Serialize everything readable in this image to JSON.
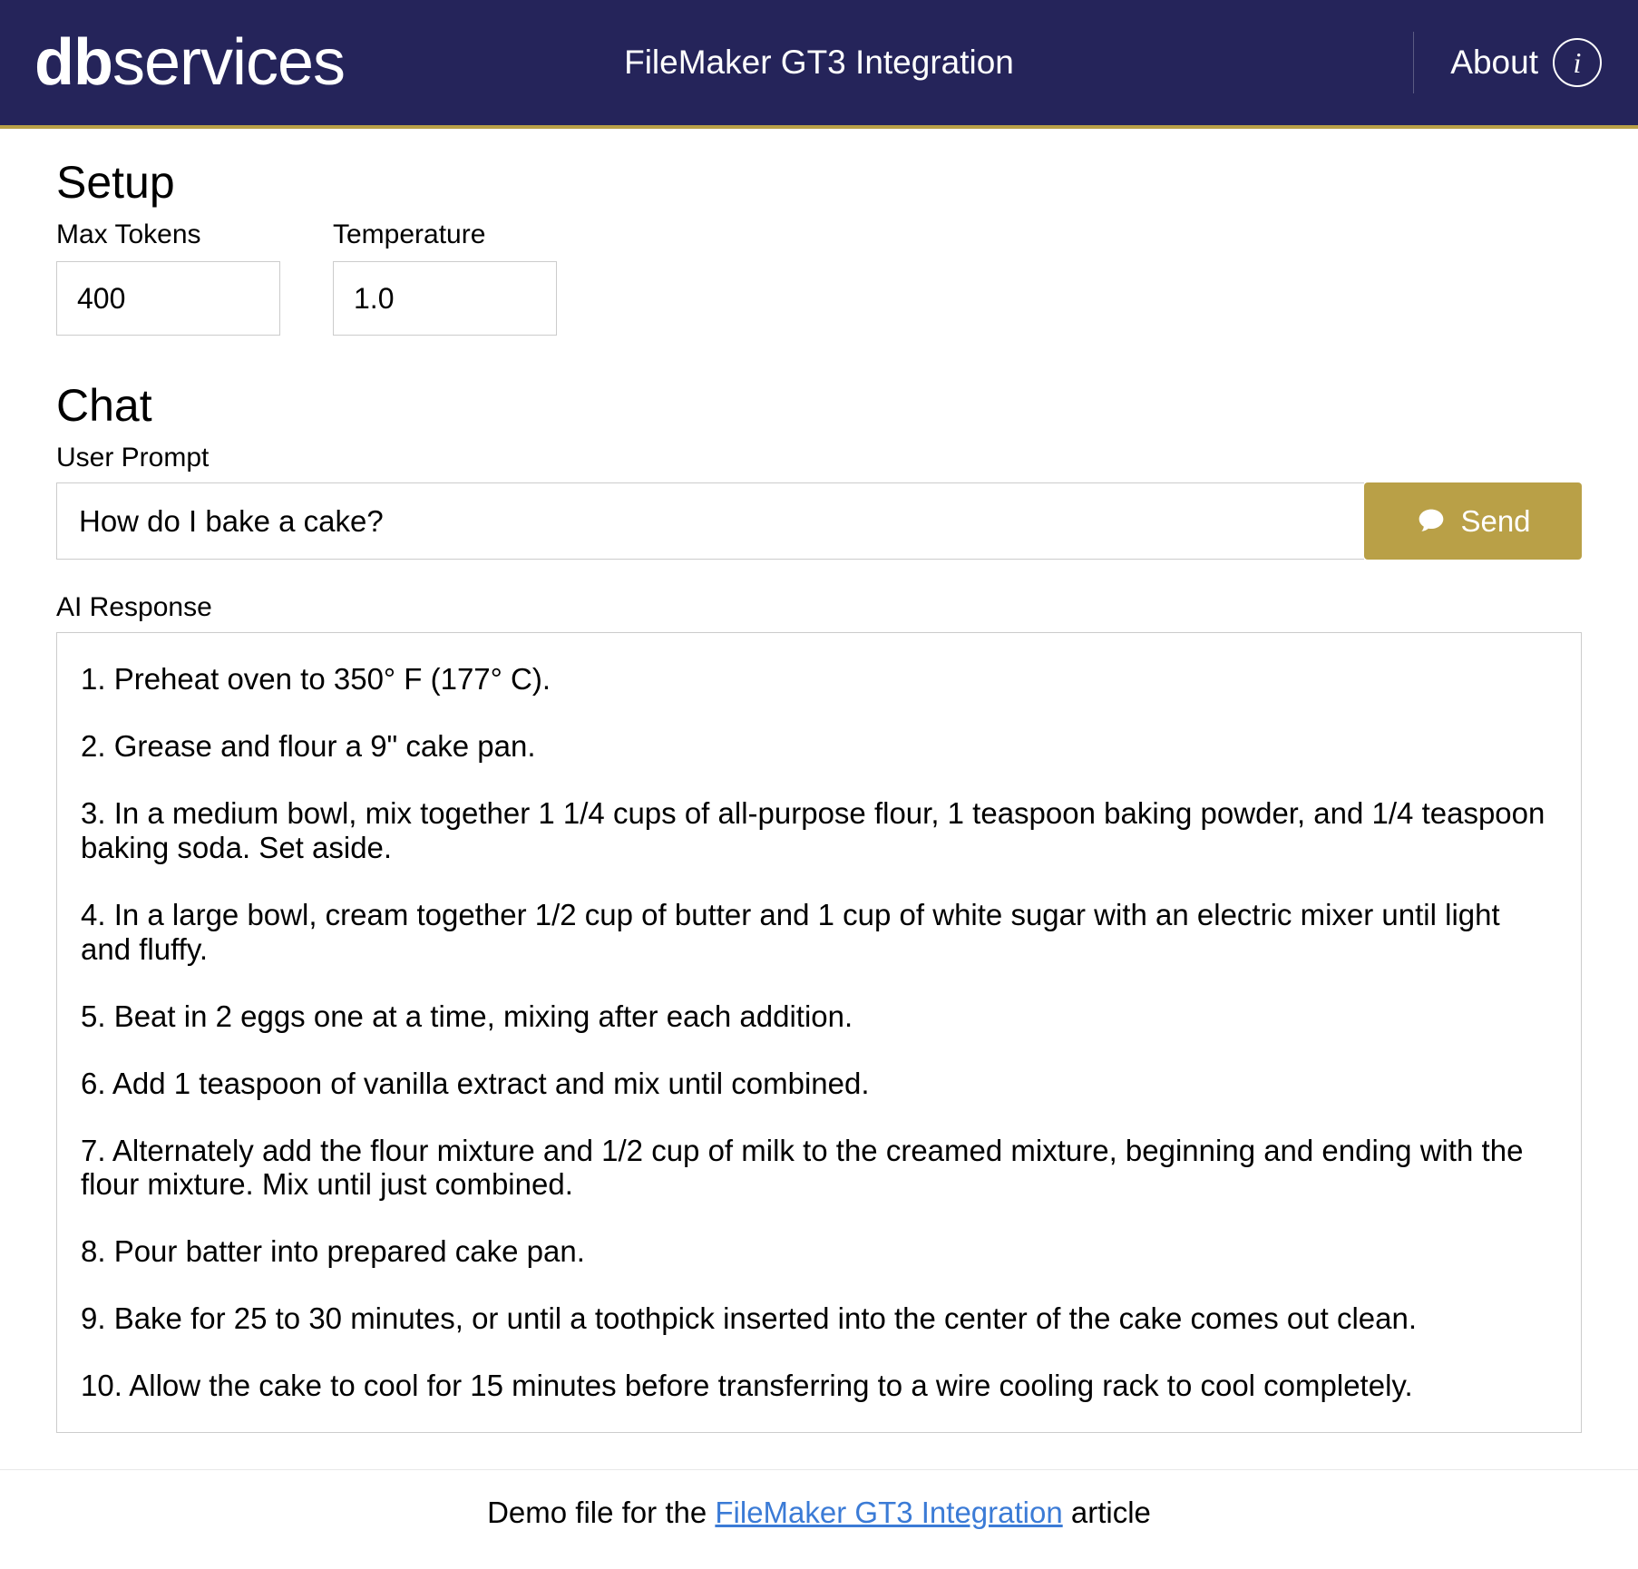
{
  "header": {
    "logo_bold": "db",
    "logo_light": "services",
    "title": "FileMaker GT3 Integration",
    "about_label": "About"
  },
  "setup": {
    "heading": "Setup",
    "max_tokens_label": "Max Tokens",
    "max_tokens_value": "400",
    "temperature_label": "Temperature",
    "temperature_value": "1.0"
  },
  "chat": {
    "heading": "Chat",
    "prompt_label": "User Prompt",
    "prompt_value": "How do I bake a cake?",
    "send_label": "Send",
    "response_label": "AI Response",
    "response_lines": [
      "1. Preheat oven to 350° F (177° C).",
      "2. Grease and flour a 9\" cake pan.",
      "3. In a medium bowl, mix together 1 1/4 cups of all-purpose flour, 1 teaspoon baking powder, and 1/4 teaspoon baking soda. Set aside.",
      "4. In a large bowl, cream together 1/2 cup of butter and 1 cup of white sugar with an electric mixer until light and fluffy.",
      "5. Beat in 2 eggs one at a time, mixing after each addition.",
      "6. Add 1 teaspoon of vanilla extract and mix until combined.",
      "7. Alternately add the flour mixture and 1/2 cup of milk to the creamed mixture, beginning and ending with the flour mixture. Mix until just combined.",
      "8. Pour batter into prepared cake pan.",
      "9. Bake for 25 to 30 minutes, or until a toothpick inserted into the center of the cake comes out clean.",
      "10. Allow the cake to cool for 15 minutes before transferring to a wire cooling rack to cool completely."
    ]
  },
  "footer": {
    "prefix": "Demo file for the ",
    "link_text": "FileMaker GT3 Integration",
    "suffix": " article"
  }
}
